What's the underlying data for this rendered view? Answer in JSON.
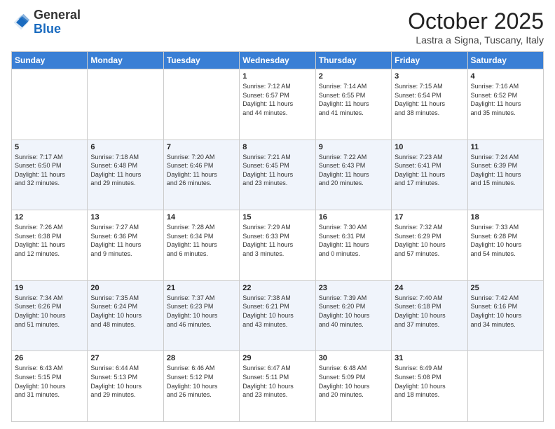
{
  "header": {
    "logo_general": "General",
    "logo_blue": "Blue",
    "month_title": "October 2025",
    "location": "Lastra a Signa, Tuscany, Italy"
  },
  "weekdays": [
    "Sunday",
    "Monday",
    "Tuesday",
    "Wednesday",
    "Thursday",
    "Friday",
    "Saturday"
  ],
  "weeks": [
    [
      {
        "day": "",
        "info": ""
      },
      {
        "day": "",
        "info": ""
      },
      {
        "day": "",
        "info": ""
      },
      {
        "day": "1",
        "info": "Sunrise: 7:12 AM\nSunset: 6:57 PM\nDaylight: 11 hours\nand 44 minutes."
      },
      {
        "day": "2",
        "info": "Sunrise: 7:14 AM\nSunset: 6:55 PM\nDaylight: 11 hours\nand 41 minutes."
      },
      {
        "day": "3",
        "info": "Sunrise: 7:15 AM\nSunset: 6:54 PM\nDaylight: 11 hours\nand 38 minutes."
      },
      {
        "day": "4",
        "info": "Sunrise: 7:16 AM\nSunset: 6:52 PM\nDaylight: 11 hours\nand 35 minutes."
      }
    ],
    [
      {
        "day": "5",
        "info": "Sunrise: 7:17 AM\nSunset: 6:50 PM\nDaylight: 11 hours\nand 32 minutes."
      },
      {
        "day": "6",
        "info": "Sunrise: 7:18 AM\nSunset: 6:48 PM\nDaylight: 11 hours\nand 29 minutes."
      },
      {
        "day": "7",
        "info": "Sunrise: 7:20 AM\nSunset: 6:46 PM\nDaylight: 11 hours\nand 26 minutes."
      },
      {
        "day": "8",
        "info": "Sunrise: 7:21 AM\nSunset: 6:45 PM\nDaylight: 11 hours\nand 23 minutes."
      },
      {
        "day": "9",
        "info": "Sunrise: 7:22 AM\nSunset: 6:43 PM\nDaylight: 11 hours\nand 20 minutes."
      },
      {
        "day": "10",
        "info": "Sunrise: 7:23 AM\nSunset: 6:41 PM\nDaylight: 11 hours\nand 17 minutes."
      },
      {
        "day": "11",
        "info": "Sunrise: 7:24 AM\nSunset: 6:39 PM\nDaylight: 11 hours\nand 15 minutes."
      }
    ],
    [
      {
        "day": "12",
        "info": "Sunrise: 7:26 AM\nSunset: 6:38 PM\nDaylight: 11 hours\nand 12 minutes."
      },
      {
        "day": "13",
        "info": "Sunrise: 7:27 AM\nSunset: 6:36 PM\nDaylight: 11 hours\nand 9 minutes."
      },
      {
        "day": "14",
        "info": "Sunrise: 7:28 AM\nSunset: 6:34 PM\nDaylight: 11 hours\nand 6 minutes."
      },
      {
        "day": "15",
        "info": "Sunrise: 7:29 AM\nSunset: 6:33 PM\nDaylight: 11 hours\nand 3 minutes."
      },
      {
        "day": "16",
        "info": "Sunrise: 7:30 AM\nSunset: 6:31 PM\nDaylight: 11 hours\nand 0 minutes."
      },
      {
        "day": "17",
        "info": "Sunrise: 7:32 AM\nSunset: 6:29 PM\nDaylight: 10 hours\nand 57 minutes."
      },
      {
        "day": "18",
        "info": "Sunrise: 7:33 AM\nSunset: 6:28 PM\nDaylight: 10 hours\nand 54 minutes."
      }
    ],
    [
      {
        "day": "19",
        "info": "Sunrise: 7:34 AM\nSunset: 6:26 PM\nDaylight: 10 hours\nand 51 minutes."
      },
      {
        "day": "20",
        "info": "Sunrise: 7:35 AM\nSunset: 6:24 PM\nDaylight: 10 hours\nand 48 minutes."
      },
      {
        "day": "21",
        "info": "Sunrise: 7:37 AM\nSunset: 6:23 PM\nDaylight: 10 hours\nand 46 minutes."
      },
      {
        "day": "22",
        "info": "Sunrise: 7:38 AM\nSunset: 6:21 PM\nDaylight: 10 hours\nand 43 minutes."
      },
      {
        "day": "23",
        "info": "Sunrise: 7:39 AM\nSunset: 6:20 PM\nDaylight: 10 hours\nand 40 minutes."
      },
      {
        "day": "24",
        "info": "Sunrise: 7:40 AM\nSunset: 6:18 PM\nDaylight: 10 hours\nand 37 minutes."
      },
      {
        "day": "25",
        "info": "Sunrise: 7:42 AM\nSunset: 6:16 PM\nDaylight: 10 hours\nand 34 minutes."
      }
    ],
    [
      {
        "day": "26",
        "info": "Sunrise: 6:43 AM\nSunset: 5:15 PM\nDaylight: 10 hours\nand 31 minutes."
      },
      {
        "day": "27",
        "info": "Sunrise: 6:44 AM\nSunset: 5:13 PM\nDaylight: 10 hours\nand 29 minutes."
      },
      {
        "day": "28",
        "info": "Sunrise: 6:46 AM\nSunset: 5:12 PM\nDaylight: 10 hours\nand 26 minutes."
      },
      {
        "day": "29",
        "info": "Sunrise: 6:47 AM\nSunset: 5:11 PM\nDaylight: 10 hours\nand 23 minutes."
      },
      {
        "day": "30",
        "info": "Sunrise: 6:48 AM\nSunset: 5:09 PM\nDaylight: 10 hours\nand 20 minutes."
      },
      {
        "day": "31",
        "info": "Sunrise: 6:49 AM\nSunset: 5:08 PM\nDaylight: 10 hours\nand 18 minutes."
      },
      {
        "day": "",
        "info": ""
      }
    ]
  ]
}
